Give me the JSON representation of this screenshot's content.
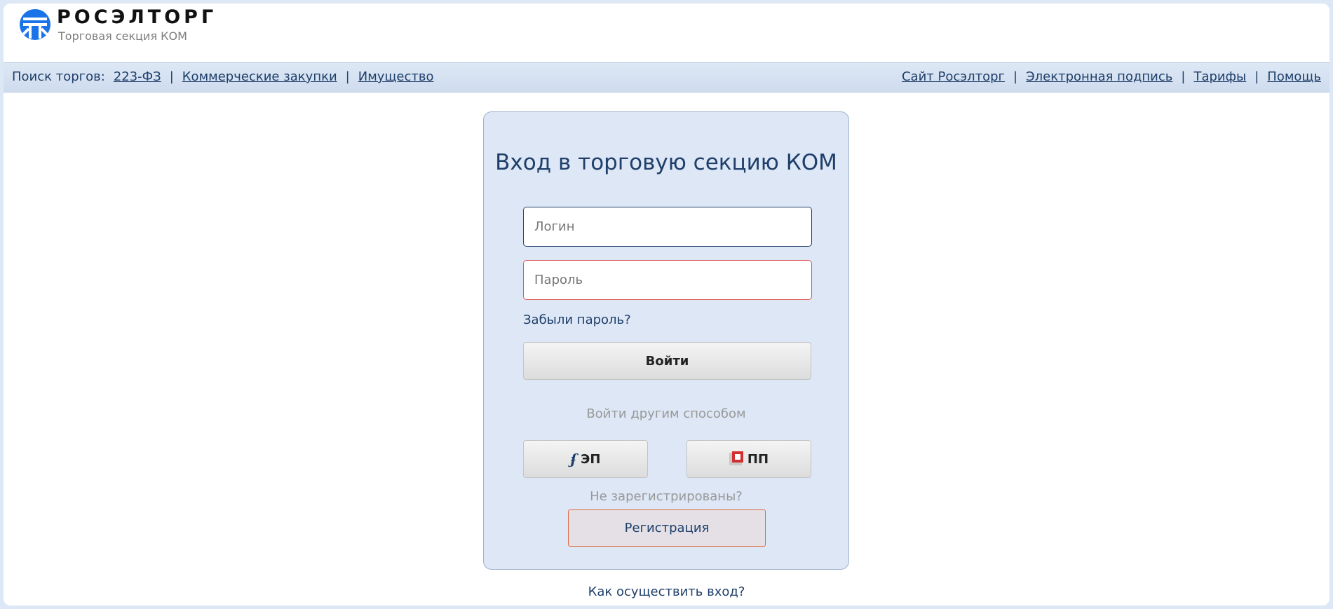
{
  "header": {
    "logo_icon": "roseltorg-logo-icon",
    "logo_title": "РОСЭЛТОРГ",
    "logo_subtitle": "Торговая секция КОМ"
  },
  "nav": {
    "search_label": "Поиск торгов:",
    "left_links": [
      "223-ФЗ",
      "Коммерческие закупки",
      "Имущество"
    ],
    "right_links": [
      "Сайт Росэлторг",
      "Электронная подпись",
      "Тарифы",
      "Помощь"
    ],
    "separator": "|"
  },
  "login": {
    "title": "Вход в торговую секцию КОМ",
    "login_placeholder": "Логин",
    "login_value": "",
    "password_placeholder": "Пароль",
    "password_value": "",
    "forgot_password": "Забыли пароль?",
    "submit_label": "Войти",
    "alt_methods_label": "Войти другим способом",
    "ep_label": "ЭП",
    "ep_icon": "signature-icon",
    "pp_label": "ПП",
    "pp_icon": "pp-logo-icon",
    "not_registered": "Не зарегистрированы?",
    "register_label": "Регистрация"
  },
  "footer": {
    "how_to_login": "Как осуществить вход?"
  },
  "colors": {
    "brand_blue": "#1f3f6a",
    "logo_blue": "#1a73e8",
    "card_bg": "#dde7f6",
    "error_border": "#d9534f",
    "register_border": "#e0683f"
  }
}
